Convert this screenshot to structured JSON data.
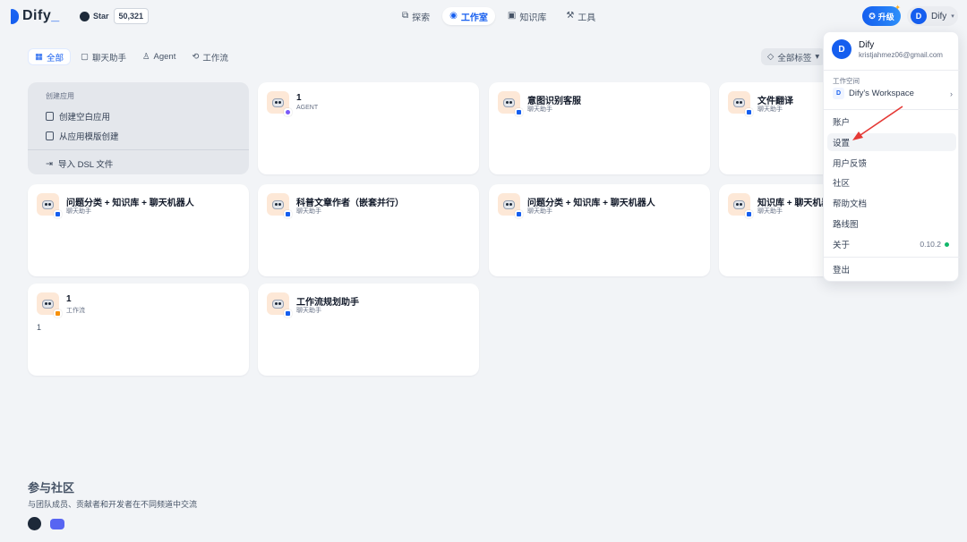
{
  "brand": {
    "name_main": "Dify",
    "name_suffix": "_"
  },
  "github": {
    "star_label": "Star",
    "star_count": "50,321"
  },
  "nav": [
    {
      "label": "探索",
      "icon": "explore-icon",
      "active": false
    },
    {
      "label": "工作室",
      "icon": "robot-icon",
      "active": true
    },
    {
      "label": "知识库",
      "icon": "book-icon",
      "active": false
    },
    {
      "label": "工具",
      "icon": "tool-icon",
      "active": false
    }
  ],
  "upgrade_label": "升级",
  "user": {
    "initial": "D",
    "name": "Dify"
  },
  "filters": [
    {
      "label": "全部",
      "active": true
    },
    {
      "label": "聊天助手",
      "active": false
    },
    {
      "label": "Agent",
      "active": false
    },
    {
      "label": "工作流",
      "active": false
    }
  ],
  "tag_filter_label": "全部标签",
  "create": {
    "title": "创建应用",
    "blank": "创建空白应用",
    "template": "从应用模版创建",
    "dsl": "导入 DSL 文件"
  },
  "apps": [
    {
      "name": "1",
      "type": "AGENT",
      "desc": ""
    },
    {
      "name": "意图识别客服",
      "type": "聊天助手",
      "desc": ""
    },
    {
      "name": "文件翻译",
      "type": "聊天助手",
      "desc": ""
    },
    {
      "name": "问题分类 + 知识库 + 聊天机器人",
      "type": "聊天助手",
      "desc": ""
    },
    {
      "name": "科普文章作者（嵌套并行）",
      "type": "聊天助手",
      "desc": ""
    },
    {
      "name": "问题分类 + 知识库 + 聊天机器人",
      "type": "聊天助手",
      "desc": ""
    },
    {
      "name": "知识库 + 聊天机器",
      "type": "聊天助手",
      "desc": ""
    },
    {
      "name": "1",
      "type": "工作流",
      "desc": "1"
    },
    {
      "name": "工作流规划助手",
      "type": "聊天助手",
      "desc": ""
    }
  ],
  "community": {
    "title": "参与社区",
    "subtitle": "与团队成员、贡献者和开发者在不同频道中交流"
  },
  "menu": {
    "user_initial": "D",
    "user_name": "Dify",
    "email": "kristjahmez06@gmail.com",
    "workspace_label": "工作空间",
    "workspace_initial": "D",
    "workspace_name": "Dify's Workspace",
    "items": [
      "账户",
      "设置",
      "用户反馈",
      "社区",
      "帮助文档",
      "路线图"
    ],
    "about": "关于",
    "version": "0.10.2",
    "logout": "登出"
  },
  "colors": {
    "accent": "#155eef",
    "status_ok": "#12b76a",
    "annotation_arrow": "#e53935"
  }
}
